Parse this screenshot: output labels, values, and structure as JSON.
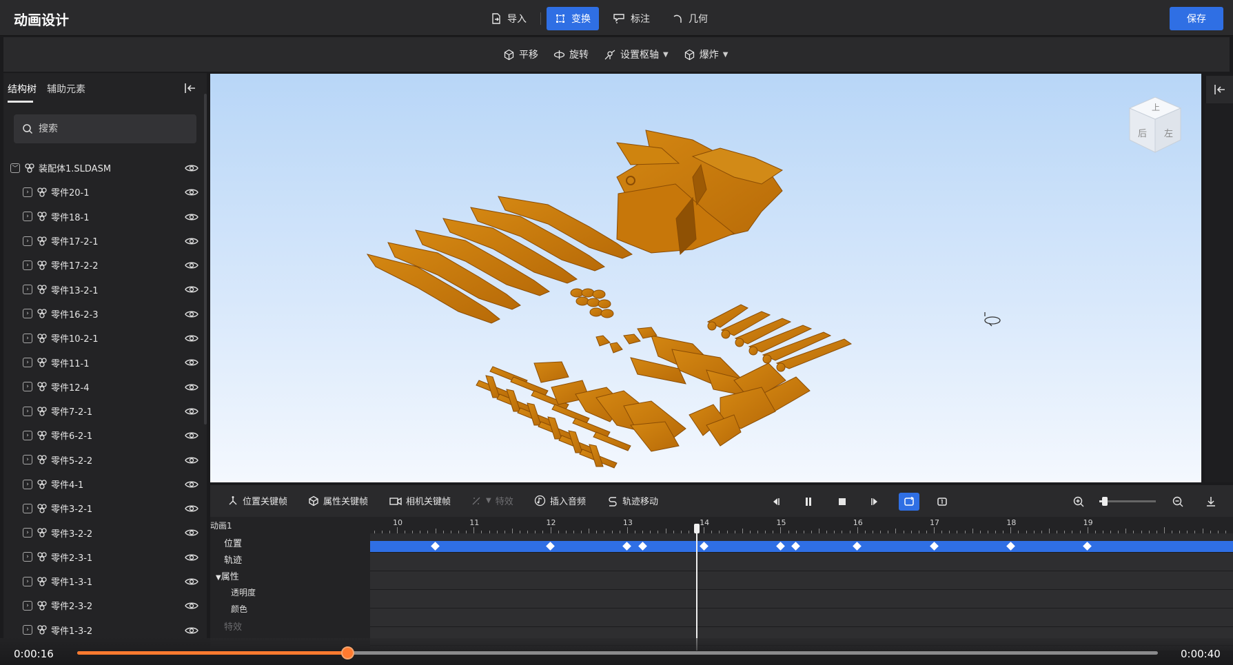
{
  "app": {
    "title": "动画设计",
    "save_label": "保存"
  },
  "topnav": {
    "items": [
      {
        "label": "导入",
        "icon": "import-icon",
        "active": false
      },
      {
        "label": "变换",
        "icon": "transform-icon",
        "active": true
      },
      {
        "label": "标注",
        "icon": "annotation-icon",
        "active": false
      },
      {
        "label": "几何",
        "icon": "geometry-icon",
        "active": false
      }
    ]
  },
  "subnav": {
    "items": [
      {
        "label": "平移",
        "icon": "move-icon",
        "dropdown": false
      },
      {
        "label": "旋转",
        "icon": "rotate-icon",
        "dropdown": false
      },
      {
        "label": "设置枢轴",
        "icon": "pivot-icon",
        "dropdown": true
      },
      {
        "label": "爆炸",
        "icon": "explode-icon",
        "dropdown": true
      }
    ]
  },
  "leftpanel": {
    "tabs": [
      {
        "label": "结构树",
        "active": true
      },
      {
        "label": "辅助元素",
        "active": false
      }
    ],
    "search_placeholder": "搜索",
    "tree": [
      {
        "label": "装配体1.SLDASM",
        "level": 0,
        "expanded": true
      },
      {
        "label": "零件20-1",
        "level": 1
      },
      {
        "label": "零件18-1",
        "level": 1
      },
      {
        "label": "零件17-2-1",
        "level": 1
      },
      {
        "label": "零件17-2-2",
        "level": 1
      },
      {
        "label": "零件13-2-1",
        "level": 1
      },
      {
        "label": "零件16-2-3",
        "level": 1
      },
      {
        "label": "零件10-2-1",
        "level": 1
      },
      {
        "label": "零件11-1",
        "level": 1
      },
      {
        "label": "零件12-4",
        "level": 1
      },
      {
        "label": "零件7-2-1",
        "level": 1
      },
      {
        "label": "零件6-2-1",
        "level": 1
      },
      {
        "label": "零件5-2-2",
        "level": 1
      },
      {
        "label": "零件4-1",
        "level": 1
      },
      {
        "label": "零件3-2-1",
        "level": 1
      },
      {
        "label": "零件3-2-2",
        "level": 1
      },
      {
        "label": "零件2-3-1",
        "level": 1
      },
      {
        "label": "零件1-3-1",
        "level": 1
      },
      {
        "label": "零件2-3-2",
        "level": 1
      },
      {
        "label": "零件1-3-2",
        "level": 1
      }
    ]
  },
  "viewcube": {
    "faces": [
      "上",
      "后",
      "左"
    ]
  },
  "timeline": {
    "toolbar": [
      {
        "label": "位置关键帧",
        "icon": "position-keyframe-icon",
        "enabled": true
      },
      {
        "label": "属性关键帧",
        "icon": "property-keyframe-icon",
        "enabled": true
      },
      {
        "label": "相机关键帧",
        "icon": "camera-keyframe-icon",
        "enabled": true
      },
      {
        "label": "特效",
        "icon": "effect-icon",
        "enabled": false
      },
      {
        "label": "插入音频",
        "icon": "audio-icon",
        "enabled": true
      },
      {
        "label": "轨迹移动",
        "icon": "track-move-icon",
        "enabled": true
      }
    ],
    "animation_name": "动画1",
    "properties": {
      "position": "位置",
      "track": "轨迹",
      "attributes": "属性",
      "opacity": "透明度",
      "color": "颜色",
      "effect": "特效"
    },
    "ruler_labels": [
      "10",
      "11",
      "12",
      "13",
      "14",
      "15",
      "16",
      "17",
      "18",
      "19"
    ],
    "position_keyframes": [
      10.5,
      12.0,
      13.0,
      13.2,
      14.0,
      15.0,
      15.2,
      16.0,
      17.0,
      18.0,
      19.0
    ],
    "playhead_value": 13.9,
    "zoom_level": 0.1
  },
  "player": {
    "current_time": "0:00:16",
    "total_time": "0:00:40",
    "progress": 0.25
  },
  "colors": {
    "accent": "#2f6fe4",
    "part": "#c8780b",
    "progress": "#ff7a2f"
  }
}
